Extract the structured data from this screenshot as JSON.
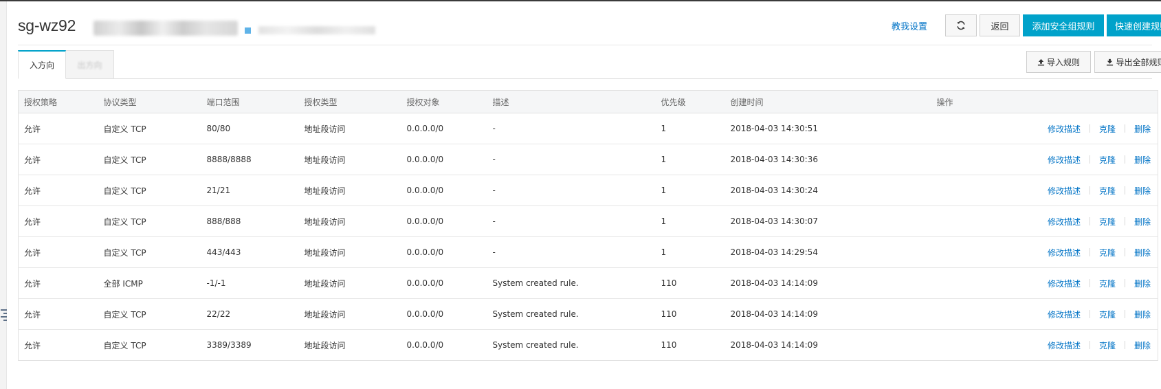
{
  "header": {
    "title": "sg-wz92",
    "title_tail": "kxvg...",
    "id_tail": "3",
    "help_link": "教我设置",
    "back_label": "返回",
    "add_rule_label": "添加安全组规则",
    "quick_create_label": "快速创建规则"
  },
  "tabs": {
    "inbound": "入方向",
    "outbound": "出方向"
  },
  "actions": {
    "import_label": "导入规则",
    "export_label": "导出全部规则"
  },
  "table": {
    "columns": [
      "授权策略",
      "协议类型",
      "端口范围",
      "授权类型",
      "授权对象",
      "描述",
      "优先级",
      "创建时间",
      "操作"
    ],
    "rows": [
      [
        "允许",
        "自定义 TCP",
        "80/80",
        "地址段访问",
        "0.0.0.0/0",
        "-",
        "1",
        "2018-04-03 14:30:51"
      ],
      [
        "允许",
        "自定义 TCP",
        "8888/8888",
        "地址段访问",
        "0.0.0.0/0",
        "-",
        "1",
        "2018-04-03 14:30:36"
      ],
      [
        "允许",
        "自定义 TCP",
        "21/21",
        "地址段访问",
        "0.0.0.0/0",
        "-",
        "1",
        "2018-04-03 14:30:24"
      ],
      [
        "允许",
        "自定义 TCP",
        "888/888",
        "地址段访问",
        "0.0.0.0/0",
        "-",
        "1",
        "2018-04-03 14:30:07"
      ],
      [
        "允许",
        "自定义 TCP",
        "443/443",
        "地址段访问",
        "0.0.0.0/0",
        "-",
        "1",
        "2018-04-03 14:29:54"
      ],
      [
        "允许",
        "全部 ICMP",
        "-1/-1",
        "地址段访问",
        "0.0.0.0/0",
        "System created rule.",
        "110",
        "2018-04-03 14:14:09"
      ],
      [
        "允许",
        "自定义 TCP",
        "22/22",
        "地址段访问",
        "0.0.0.0/0",
        "System created rule.",
        "110",
        "2018-04-03 14:14:09"
      ],
      [
        "允许",
        "自定义 TCP",
        "3389/3389",
        "地址段访问",
        "0.0.0.0/0",
        "System created rule.",
        "110",
        "2018-04-03 14:14:09"
      ]
    ],
    "row_actions": [
      "修改描述",
      "克隆",
      "删除"
    ]
  },
  "colors": {
    "primary": "#00a2ca",
    "link": "#0073c6"
  },
  "icons": {
    "refresh": "refresh-icon",
    "import": "upload-icon",
    "export": "download-icon",
    "sidebar_toggle": "menu-toggle-icon"
  }
}
